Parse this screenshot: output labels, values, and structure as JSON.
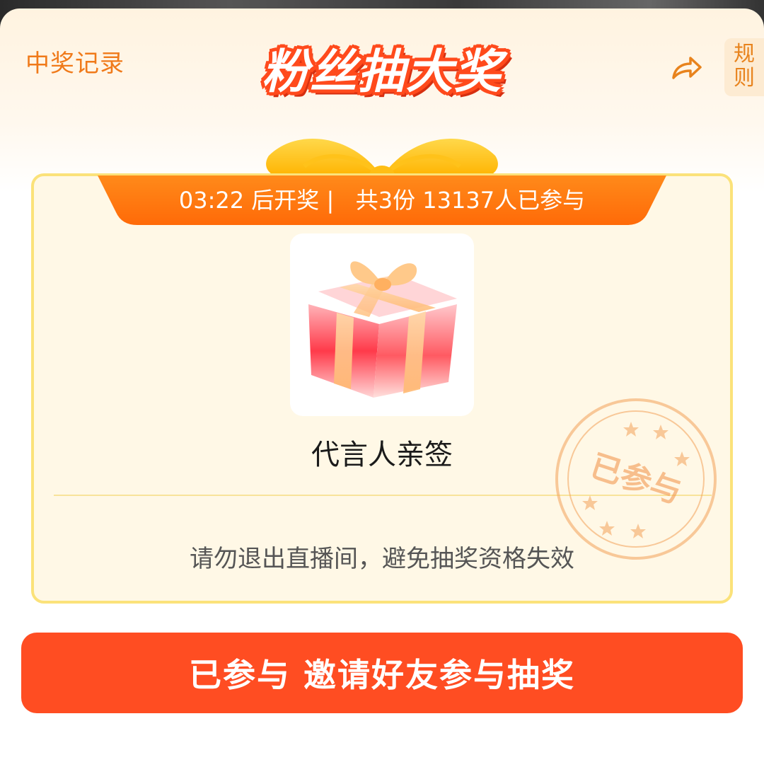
{
  "header": {
    "records_link": "中奖记录",
    "title": "粉丝抽大奖",
    "share_icon": "share-arrow-icon",
    "rules_label": [
      "规",
      "则"
    ]
  },
  "lottery": {
    "status_line": "03:22 后开奖 |   共3份 13137人已参与",
    "prize_name": "代言人亲签",
    "prize_icon": "gift-box-icon",
    "notice": "请勿退出直播间，避免抽奖资格失效",
    "stamp_text": "已参与"
  },
  "action": {
    "cta_label": "已参与 邀请好友参与抽奖"
  },
  "colors": {
    "accent_orange": "#ff7a12",
    "cta_red": "#ff4d22",
    "card_border": "#fbe27a",
    "link_orange": "#f07a1a"
  }
}
